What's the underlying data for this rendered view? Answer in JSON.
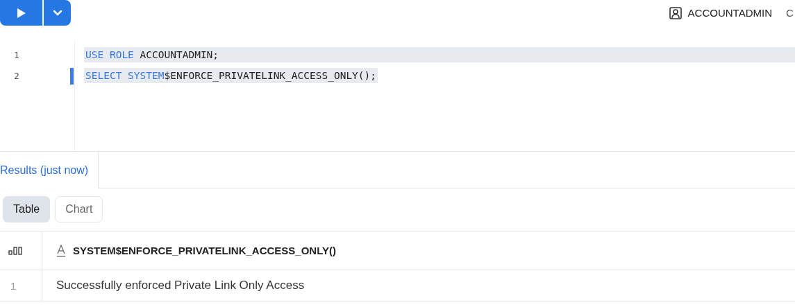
{
  "toolbar": {
    "role": "ACCOUNTADMIN",
    "cut_text": "C"
  },
  "editor": {
    "lines": [
      {
        "number": "1",
        "active": false,
        "selected": true,
        "tokens": [
          {
            "kind": "keyword",
            "text": "USE ROLE "
          },
          {
            "kind": "plain",
            "text": "ACCOUNTADMIN;"
          }
        ]
      },
      {
        "number": "2",
        "active": true,
        "selected": true,
        "tokens": [
          {
            "kind": "keyword",
            "text": "SELECT SYSTEM"
          },
          {
            "kind": "plain",
            "text": "$ENFORCE_PRIVATELINK_ACCESS_ONLY();"
          }
        ]
      }
    ]
  },
  "result_tabs": [
    {
      "label": "Results (just now)",
      "selected": true
    }
  ],
  "view_toggle": [
    {
      "label": "Table",
      "selected": true
    },
    {
      "label": "Chart",
      "selected": false
    }
  ],
  "table": {
    "columns": [
      {
        "label": "SYSTEM$ENFORCE_PRIVATELINK_ACCESS_ONLY()",
        "kind": "text"
      }
    ],
    "rows": [
      {
        "number": "1",
        "cells": [
          "Successfully enforced Private Link Only Access"
        ]
      }
    ]
  }
}
